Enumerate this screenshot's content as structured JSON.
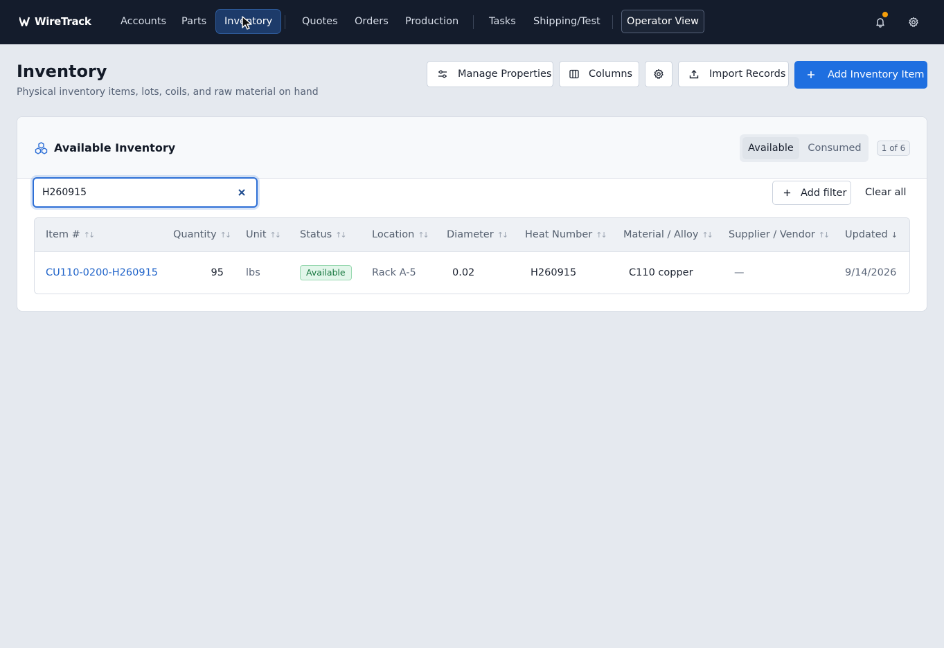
{
  "app": {
    "brand": "WireTrack"
  },
  "nav": {
    "items": [
      {
        "label": "Accounts"
      },
      {
        "label": "Parts"
      },
      {
        "label": "Inventory",
        "active": true
      },
      {
        "label": "Quotes"
      },
      {
        "label": "Orders"
      },
      {
        "label": "Production"
      },
      {
        "label": "Tasks"
      },
      {
        "label": "Shipping/Test"
      }
    ],
    "operator_view_label": "Operator View",
    "notification_icon": "bell-icon",
    "settings_icon": "gear-icon",
    "notification_dot_color": "#f59e0b"
  },
  "page": {
    "title": "Inventory",
    "subtitle": "Physical inventory items, lots, coils, and raw material on hand"
  },
  "actions": {
    "manage_properties": "Manage Properties",
    "columns": "Columns",
    "settings_icon": "gear-icon",
    "import_records": "Import Records",
    "add_item": "Add Inventory Item",
    "primary_color": "#1f6fe0"
  },
  "card": {
    "title": "Available Inventory",
    "icon": "boxes-icon",
    "segment": {
      "available": "Available",
      "consumed": "Consumed",
      "selected": "Available"
    },
    "count": "1 of 6"
  },
  "filters": {
    "search_value": "H260915",
    "add_filter": "Add filter",
    "clear_all": "Clear all"
  },
  "table": {
    "columns": [
      "Item #",
      "Quantity",
      "Unit",
      "Status",
      "Location",
      "Diameter",
      "Heat Number",
      "Material / Alloy",
      "Supplier / Vendor",
      "Updated"
    ],
    "sorted_column": "Updated",
    "sort_direction": "descending",
    "rows": [
      {
        "item": "CU110-0200-H260915",
        "quantity": "95",
        "unit": "lbs",
        "status": "Available",
        "location": "Rack A-5",
        "diameter": "0.02",
        "heat_number": "H260915",
        "material": "C110 copper",
        "supplier": "—",
        "updated": "9/14/2026"
      }
    ]
  }
}
